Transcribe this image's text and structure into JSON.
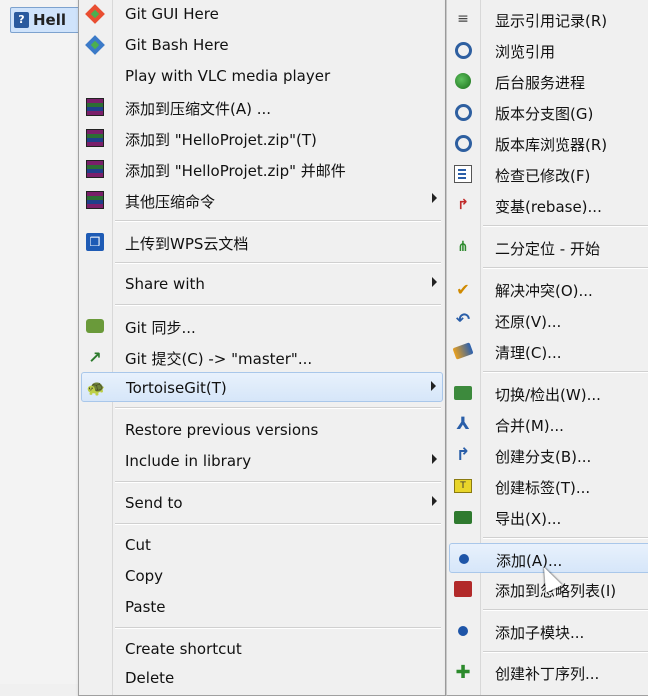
{
  "file": {
    "label": "Hell"
  },
  "main_menu": {
    "items": [
      {
        "label": "Git GUI Here"
      },
      {
        "label": "Git Bash Here"
      },
      {
        "label": "Play with VLC media player"
      },
      {
        "label": "添加到压缩文件(A) ..."
      },
      {
        "label": "添加到 \"HelloProjet.zip\"(T)"
      },
      {
        "label": "添加到 \"HelloProjet.zip\" 并邮件"
      },
      {
        "label": "其他压缩命令"
      },
      {
        "label": "上传到WPS云文档"
      },
      {
        "label": "Share with"
      },
      {
        "label": "Git 同步..."
      },
      {
        "label": "Git 提交(C) -> \"master\"..."
      },
      {
        "label": "TortoiseGit(T)"
      },
      {
        "label": "Restore previous versions"
      },
      {
        "label": "Include in library"
      },
      {
        "label": "Send to"
      },
      {
        "label": "Cut"
      },
      {
        "label": "Copy"
      },
      {
        "label": "Paste"
      },
      {
        "label": "Create shortcut"
      },
      {
        "label": "Delete"
      }
    ]
  },
  "sub_menu": {
    "items": [
      {
        "label": "显示引用记录(R)"
      },
      {
        "label": "浏览引用"
      },
      {
        "label": "后台服务进程"
      },
      {
        "label": "版本分支图(G)"
      },
      {
        "label": "版本库浏览器(R)"
      },
      {
        "label": "检查已修改(F)"
      },
      {
        "label": "变基(rebase)..."
      },
      {
        "label": "二分定位 - 开始"
      },
      {
        "label": "解决冲突(O)..."
      },
      {
        "label": "还原(V)..."
      },
      {
        "label": "清理(C)..."
      },
      {
        "label": "切换/检出(W)..."
      },
      {
        "label": "合并(M)..."
      },
      {
        "label": "创建分支(B)..."
      },
      {
        "label": "创建标签(T)..."
      },
      {
        "label": "导出(X)..."
      },
      {
        "label": "添加(A)..."
      },
      {
        "label": "添加到忽略列表(I)"
      },
      {
        "label": "添加子模块..."
      },
      {
        "label": "创建补丁序列..."
      }
    ]
  }
}
